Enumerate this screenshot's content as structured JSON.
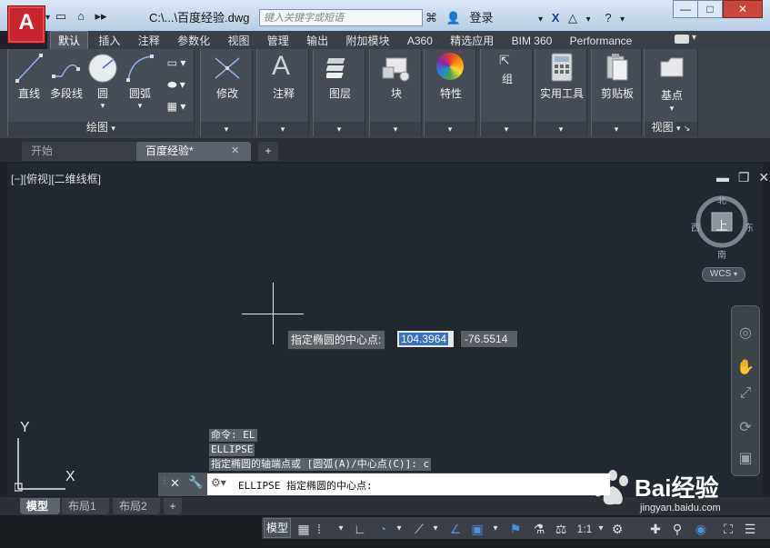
{
  "title_bar": {
    "doc_title": "C:\\...\\百度经验.dwg",
    "search_placeholder": "键入关键字或短语",
    "login_label": "登录",
    "window_buttons": [
      "—",
      "□",
      "✕"
    ]
  },
  "ribbon": {
    "tabs": [
      "默认",
      "插入",
      "注释",
      "参数化",
      "视图",
      "管理",
      "输出",
      "附加模块",
      "A360",
      "精选应用",
      "BIM 360",
      "Performance"
    ],
    "active_tab": "默认",
    "draw_tools": [
      "直线",
      "多段线",
      "圆",
      "圆弧"
    ],
    "draw_panel_label": "绘图",
    "panels": [
      "修改",
      "注释",
      "图层",
      "块",
      "特性",
      "组",
      "实用工具",
      "剪贴板",
      "基点"
    ],
    "view_panel_label": "视图"
  },
  "file_tabs": {
    "start": "开始",
    "active": "百度经验*",
    "add": "+"
  },
  "viewport": {
    "label": "[−][俯视][二维线框]",
    "viewcube": {
      "top": "上",
      "north": "北",
      "south": "南",
      "east": "东",
      "west": "西"
    },
    "wcs": "WCS"
  },
  "dynamic_input": {
    "prompt": "指定椭圆的中心点:",
    "x_value": "104.3964",
    "y_value": "-76.5514"
  },
  "ucs": {
    "y_axis": "Y",
    "x_axis": "X"
  },
  "command": {
    "history": [
      "命令: EL",
      "ELLIPSE",
      "指定椭圆的轴端点或 [圆弧(A)/中心点(C)]: c"
    ],
    "current": "ELLIPSE 指定椭圆的中心点:"
  },
  "layout_tabs": [
    "模型",
    "布局1",
    "布局2",
    "+"
  ],
  "status_bar": {
    "model_label": "模型",
    "scale": "1:1"
  },
  "watermark": {
    "main": "Bai经验",
    "sub": "jingyan.baidu.com"
  },
  "colors": {
    "accent_red": "#c8262b",
    "viewport_bg": "#212830",
    "ribbon_bg": "#464c55",
    "selection_blue": "#3b6fbf"
  }
}
